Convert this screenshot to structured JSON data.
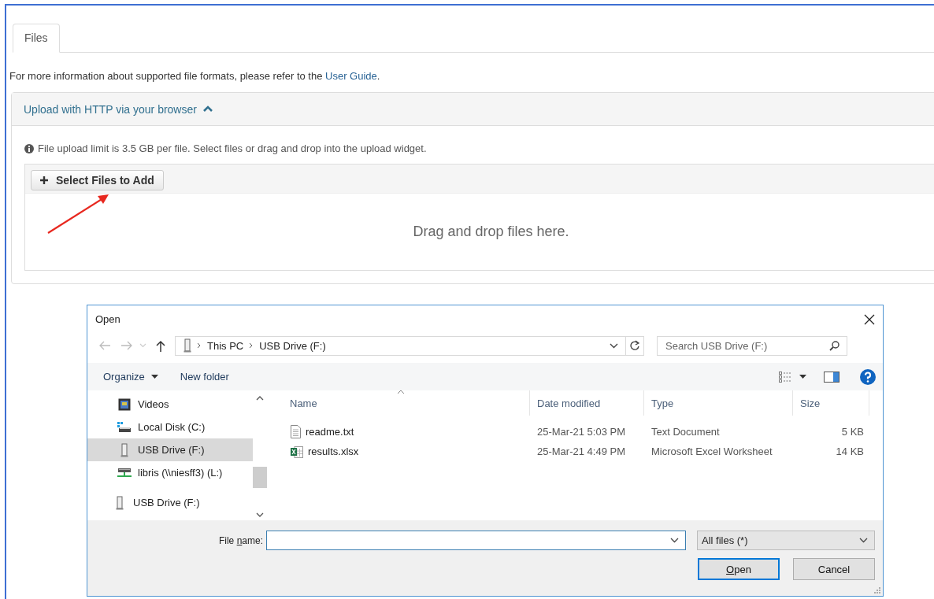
{
  "tabs": [
    {
      "label": "Files",
      "selected": true
    }
  ],
  "info": {
    "text": "For more information about supported file formats, please refer to the ",
    "link": "User Guide",
    "after": "."
  },
  "upload_panel": {
    "title": "Upload with HTTP via your browser",
    "expanded": true,
    "limit_note": "File upload limit is 3.5 GB per file. Select files or drag and drop into the upload widget.",
    "add_button": "Select Files to Add",
    "drop_hint": "Drag and drop files here."
  },
  "dialog": {
    "title": "Open",
    "path": [
      "This PC",
      "USB Drive (F:)"
    ],
    "search": {
      "placeholder": "Search USB Drive (F:)"
    },
    "toolbar": {
      "organize": "Organize",
      "new_folder": "New folder"
    },
    "nav": [
      {
        "children": [
          {
            "label": "Videos",
            "kind": "videos",
            "selected": false
          },
          {
            "label": "Local Disk (C:)",
            "kind": "disk",
            "selected": false
          },
          {
            "label": "USB Drive (F:)",
            "kind": "usb",
            "selected": true
          },
          {
            "label": "libris (\\\\niesff3) (L:)",
            "kind": "network",
            "selected": false
          }
        ]
      },
      {
        "label": "USB Drive (F:)",
        "kind": "usb",
        "selected": false
      }
    ],
    "columns": [
      {
        "label": "Name",
        "sorted": true
      },
      {
        "label": "Date modified",
        "sorted": false
      },
      {
        "label": "Type",
        "sorted": false
      },
      {
        "label": "Size",
        "sorted": false
      }
    ],
    "files": [
      {
        "name": "readme.txt",
        "kind": "text",
        "date": "25-Mar-21 5:03 PM",
        "type": "Text Document",
        "size": "5 KB"
      },
      {
        "name": "results.xlsx",
        "kind": "spreadsheet",
        "date": "25-Mar-21 4:49 PM",
        "type": "Microsoft Excel Worksheet",
        "size": "14 KB"
      }
    ],
    "file_name": {
      "label_start": "File ",
      "access_key": "n",
      "label_end": "ame:"
    },
    "filter": "All files (*)",
    "buttons": [
      {
        "access_key": "O",
        "label_end": "pen",
        "default": true
      },
      {
        "label_start": "Cancel",
        "default": false
      }
    ]
  }
}
